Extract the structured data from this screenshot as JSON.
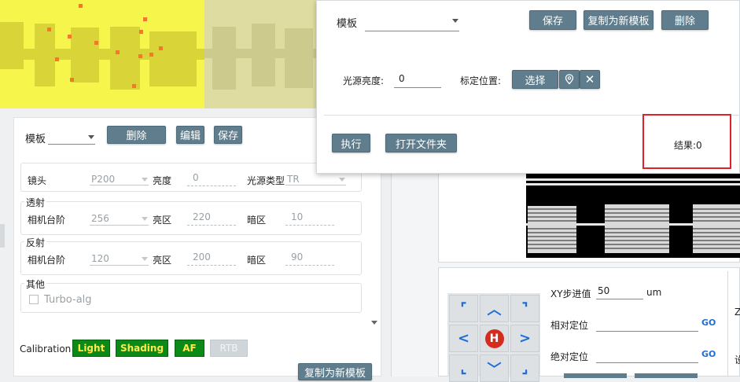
{
  "left_panel": {
    "template_label": "模板",
    "template_value": "",
    "delete_button": "删除",
    "edit_button": "编辑",
    "save_button": "保存",
    "lens_label": "镜头",
    "lens_value": "P200",
    "brightness_label": "亮度",
    "brightness_value": "0",
    "light_type_label": "光源类型",
    "light_type_value": "TR",
    "transmission": {
      "title": "透射",
      "stage_label": "相机台阶",
      "stage_value": "256",
      "bright_label": "亮区",
      "bright_value": "220",
      "dark_label": "暗区",
      "dark_value": "10"
    },
    "reflection": {
      "title": "反射",
      "stage_label": "相机台阶",
      "stage_value": "120",
      "bright_label": "亮区",
      "bright_value": "200",
      "dark_label": "暗区",
      "dark_value": "90"
    },
    "other": {
      "title": "其他",
      "turbo_label": "Turbo-alg",
      "turbo_checked": false
    },
    "calibration_label": "Calibration",
    "calibration_buttons": [
      "Light",
      "Shading",
      "AF",
      "RTB"
    ],
    "copy_new_template_button": "复制为新模板"
  },
  "dialog": {
    "template_label": "模板",
    "template_value": "",
    "save_button": "保存",
    "copy_new_template_button": "复制为新模板",
    "delete_button": "删除",
    "light_brightness_label": "光源亮度:",
    "light_brightness_value": "0",
    "calib_position_label": "标定位置:",
    "select_button": "选择",
    "execute_button": "执行",
    "open_folder_button": "打开文件夹",
    "result_text": "结果:0"
  },
  "motion": {
    "xy_step_label": "XY步进值",
    "xy_step_value": "50",
    "xy_step_unit": "um",
    "relative_label": "相对定位",
    "absolute_label": "绝对定位",
    "relative_value": "",
    "absolute_value": "",
    "go_label": "GO",
    "home_label": "H",
    "right_edge_partial_1": "Z",
    "right_edge_partial_2": "设"
  },
  "colors": {
    "button": "#5f7d8c",
    "calib_green": "#0c8a18",
    "calib_text": "#ffe94d",
    "highlight_red": "#e0202a",
    "yellow_image": "#f6f64a",
    "home_red": "#d62b1f",
    "arrow_blue": "#1e6ed6"
  }
}
